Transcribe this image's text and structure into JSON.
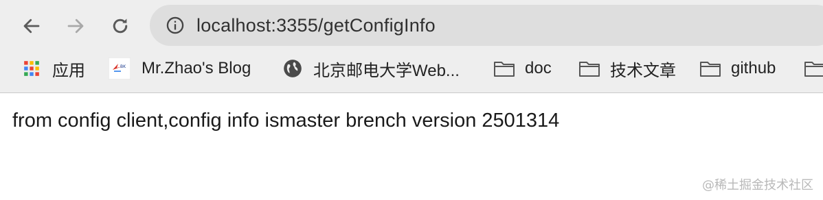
{
  "browser": {
    "url": "localhost:3355/getConfigInfo"
  },
  "icons": {
    "back": "arrow-left-icon",
    "forward": "arrow-right-icon",
    "reload": "reload-icon",
    "info": "info-icon",
    "apps": "apps-grid-icon",
    "blog": "blog-favicon",
    "globe": "globe-icon",
    "folder": "folder-icon"
  },
  "bookmarks": [
    {
      "label": "应用",
      "icon": "apps-grid-icon"
    },
    {
      "label": "Mr.Zhao's Blog",
      "icon": "blog-favicon"
    },
    {
      "label": "北京邮电大学Web...",
      "icon": "globe-icon"
    },
    {
      "label": "doc",
      "icon": "folder-icon"
    },
    {
      "label": "技术文章",
      "icon": "folder-icon"
    },
    {
      "label": "github",
      "icon": "folder-icon"
    }
  ],
  "page": {
    "body_text": "from config client,config info ismaster brench version 2501314"
  },
  "watermark": "@稀土掘金技术社区",
  "colors": {
    "chrome_bg": "#eeeeee",
    "omnibox_bg": "#dedede",
    "forward_disabled": "#a8a8a8"
  }
}
